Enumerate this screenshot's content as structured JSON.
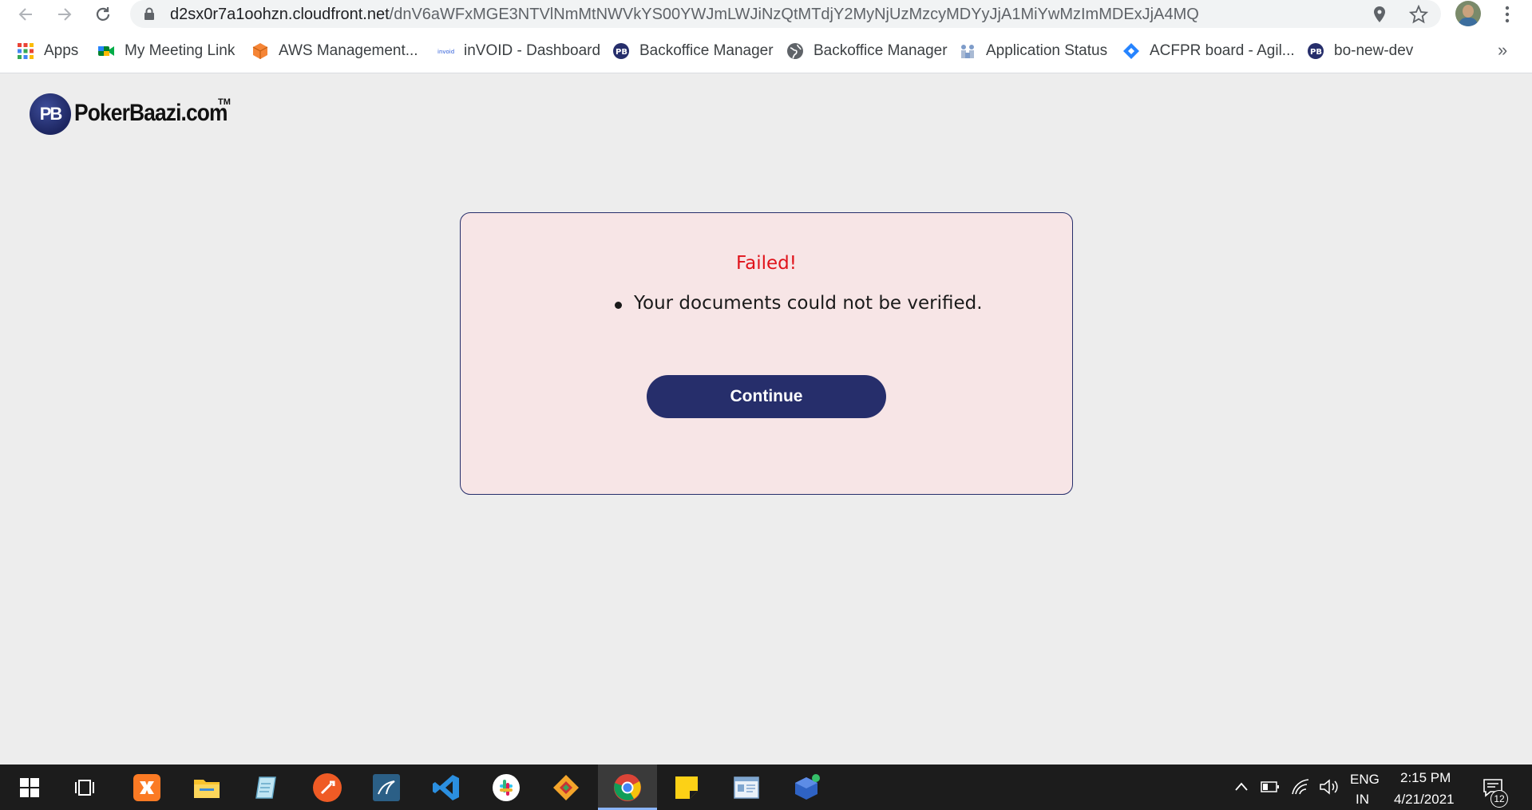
{
  "browser": {
    "url_host": "d2sx0r7a1oohzn.cloudfront.net",
    "url_path": "/dnV6aWFxMGE3NTVlNmMtNWVkYS00YWJmLWJiNzQtMTdjY2MyNjUzMzcyMDYyJjA1MiYwMzImMDExJjA4MQ",
    "bookmarks": [
      {
        "label": "Apps",
        "icon": "apps-grid-icon"
      },
      {
        "label": "My Meeting Link",
        "icon": "meet-icon"
      },
      {
        "label": "AWS Management...",
        "icon": "aws-box-icon"
      },
      {
        "label": "inVOID - Dashboard",
        "icon": "invoid-icon"
      },
      {
        "label": "Backoffice Manager",
        "icon": "pb-icon"
      },
      {
        "label": "Backoffice Manager",
        "icon": "globe-icon"
      },
      {
        "label": "Application Status",
        "icon": "status-icon"
      },
      {
        "label": "ACFPR board - Agil...",
        "icon": "jira-icon"
      },
      {
        "label": "bo-new-dev",
        "icon": "pb-icon"
      }
    ],
    "more_label": "»"
  },
  "page": {
    "logo": {
      "badge": "PB",
      "text": "PokerBaazi.com",
      "tm": "TM"
    },
    "card": {
      "title": "Failed!",
      "messages": [
        "Your documents could not be verified."
      ],
      "continue_label": "Continue"
    }
  },
  "taskbar": {
    "apps": [
      "windows-start-icon",
      "task-view-icon",
      "xampp-icon",
      "file-explorer-icon",
      "notepad-icon",
      "postman-icon",
      "mysql-workbench-icon",
      "vscode-icon",
      "slack-icon",
      "git-tool-icon",
      "chrome-icon",
      "sticky-notes-icon",
      "contacts-icon",
      "virtualbox-icon"
    ],
    "language_top": "ENG",
    "language_bottom": "IN",
    "time": "2:15 PM",
    "date": "4/21/2021",
    "notification_count": "12"
  },
  "colors": {
    "brand_navy": "#262e6b",
    "error_red": "#e0131b",
    "card_bg": "#f7e5e6",
    "page_bg": "#ededed"
  }
}
